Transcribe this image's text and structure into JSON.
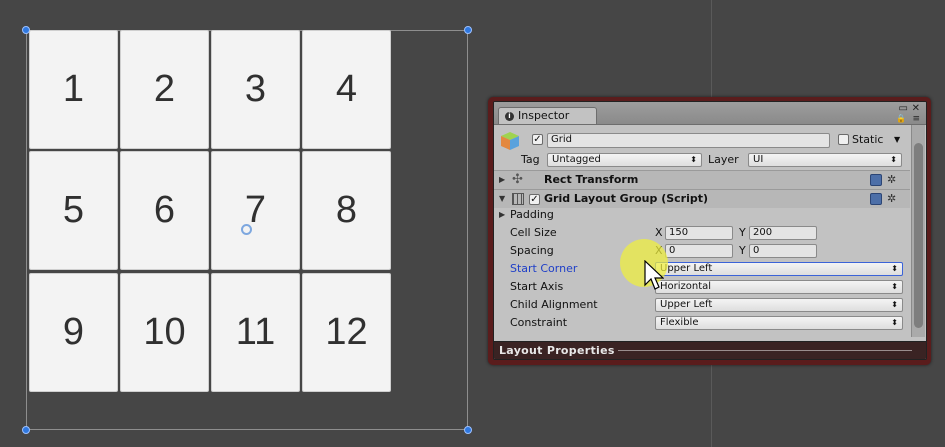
{
  "scene": {
    "cells": [
      "1",
      "2",
      "3",
      "4",
      "5",
      "6",
      "7",
      "8",
      "9",
      "10",
      "11",
      "12"
    ]
  },
  "inspector": {
    "tab_label": "Inspector",
    "object": {
      "name": "Grid",
      "active": true,
      "static_label": "Static",
      "static_checked": false,
      "tag_label": "Tag",
      "tag_value": "Untagged",
      "layer_label": "Layer",
      "layer_value": "UI"
    },
    "components": {
      "rect_transform": {
        "title": "Rect Transform"
      },
      "grid_layout": {
        "title": "Grid Layout Group (Script)",
        "enabled": true,
        "padding_label": "Padding",
        "cell_size": {
          "label": "Cell Size",
          "x_label": "X",
          "x": "150",
          "y_label": "Y",
          "y": "200"
        },
        "spacing": {
          "label": "Spacing",
          "x_label": "X",
          "x": "0",
          "y_label": "Y",
          "y": "0"
        },
        "start_corner": {
          "label": "Start Corner",
          "value": "Upper Left"
        },
        "start_axis": {
          "label": "Start Axis",
          "value": "Horizontal"
        },
        "child_alignment": {
          "label": "Child Alignment",
          "value": "Upper Left"
        },
        "constraint": {
          "label": "Constraint",
          "value": "Flexible"
        }
      }
    },
    "layout_properties_label": "Layout Properties",
    "colors": {
      "window_border": "#5a1c1c",
      "panel_bg": "#c2c2c2",
      "highlight_label": "#1f3fc8",
      "cursor_highlight": "#f0f03c"
    }
  }
}
